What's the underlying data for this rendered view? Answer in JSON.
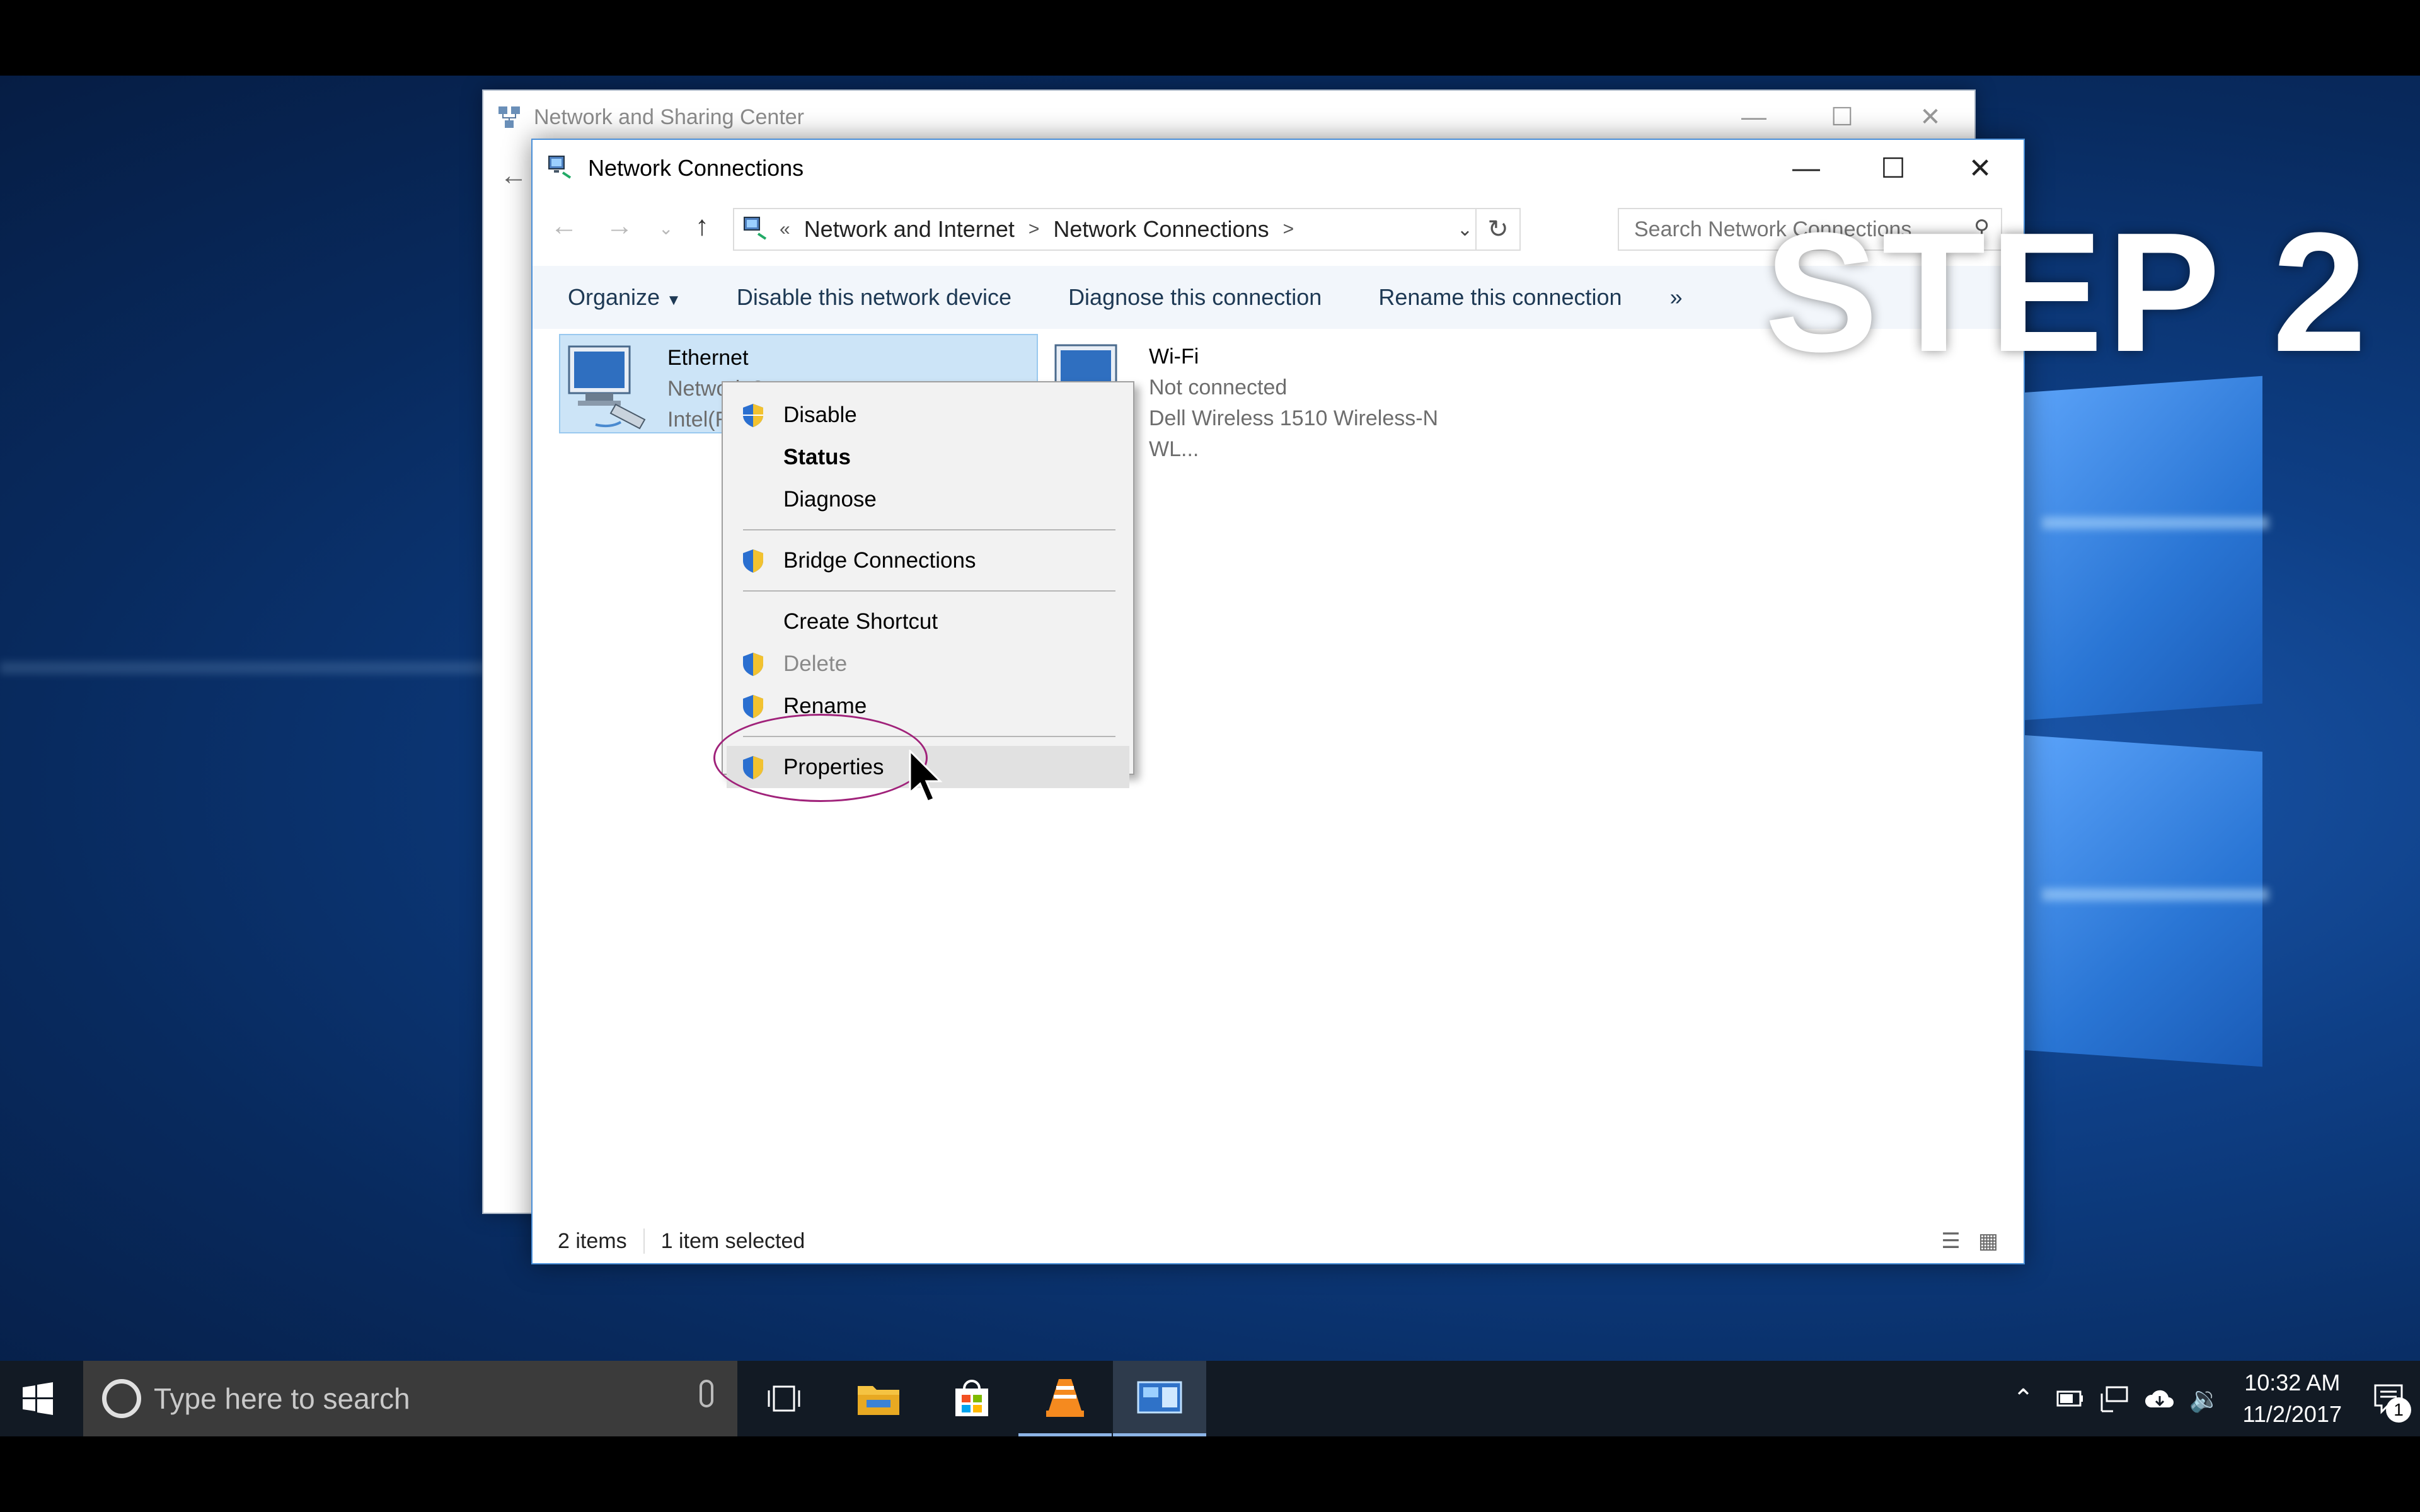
{
  "overlay": {
    "step_label": "STEP 2"
  },
  "background_window": {
    "title": "Network and Sharing Center",
    "icon": "network-sharing-icon"
  },
  "window": {
    "title": "Network Connections",
    "icon": "network-connections-icon",
    "controls": {
      "minimize": "minimize-icon",
      "maximize": "maximize-icon",
      "close": "close-icon"
    },
    "address": {
      "prefix": "«",
      "breadcrumbs": [
        "Network and Internet",
        "Network Connections"
      ],
      "separator": ">"
    },
    "search": {
      "placeholder": "Search Network Connections"
    },
    "commands": {
      "organize": "Organize",
      "disable": "Disable this network device",
      "diagnose": "Diagnose this connection",
      "rename": "Rename this connection",
      "more": "»"
    },
    "items": [
      {
        "name": "Ethernet",
        "status": "Network 2",
        "device": "Intel(R) Ethernet Connection",
        "selected": true
      },
      {
        "name": "Wi-Fi",
        "status": "Not connected",
        "device": "Dell Wireless 1510 Wireless-N WL...",
        "selected": false
      }
    ],
    "statusbar": {
      "count": "2 items",
      "selection": "1 item selected"
    }
  },
  "context_menu": {
    "items": [
      {
        "label": "Disable",
        "shield": true
      },
      {
        "label": "Status",
        "bold": true
      },
      {
        "label": "Diagnose"
      },
      {
        "label": "Bridge Connections",
        "shield": true
      },
      {
        "label": "Create Shortcut"
      },
      {
        "label": "Delete",
        "shield": true,
        "disabled": true
      },
      {
        "label": "Rename",
        "shield": true
      },
      {
        "label": "Properties",
        "shield": true,
        "highlighted": true
      }
    ]
  },
  "taskbar": {
    "search_placeholder": "Type here to search",
    "pinned": [
      "task-view-icon",
      "file-explorer-icon",
      "store-icon",
      "vlc-icon",
      "network-connections-icon"
    ],
    "clock": {
      "time": "10:32 AM",
      "date": "11/2/2017"
    },
    "notification_count": "1"
  },
  "colors": {
    "selection": "#cce4f7",
    "accent": "#4a90d9",
    "annotation": "#a0227a",
    "taskbar": "#121a24"
  }
}
